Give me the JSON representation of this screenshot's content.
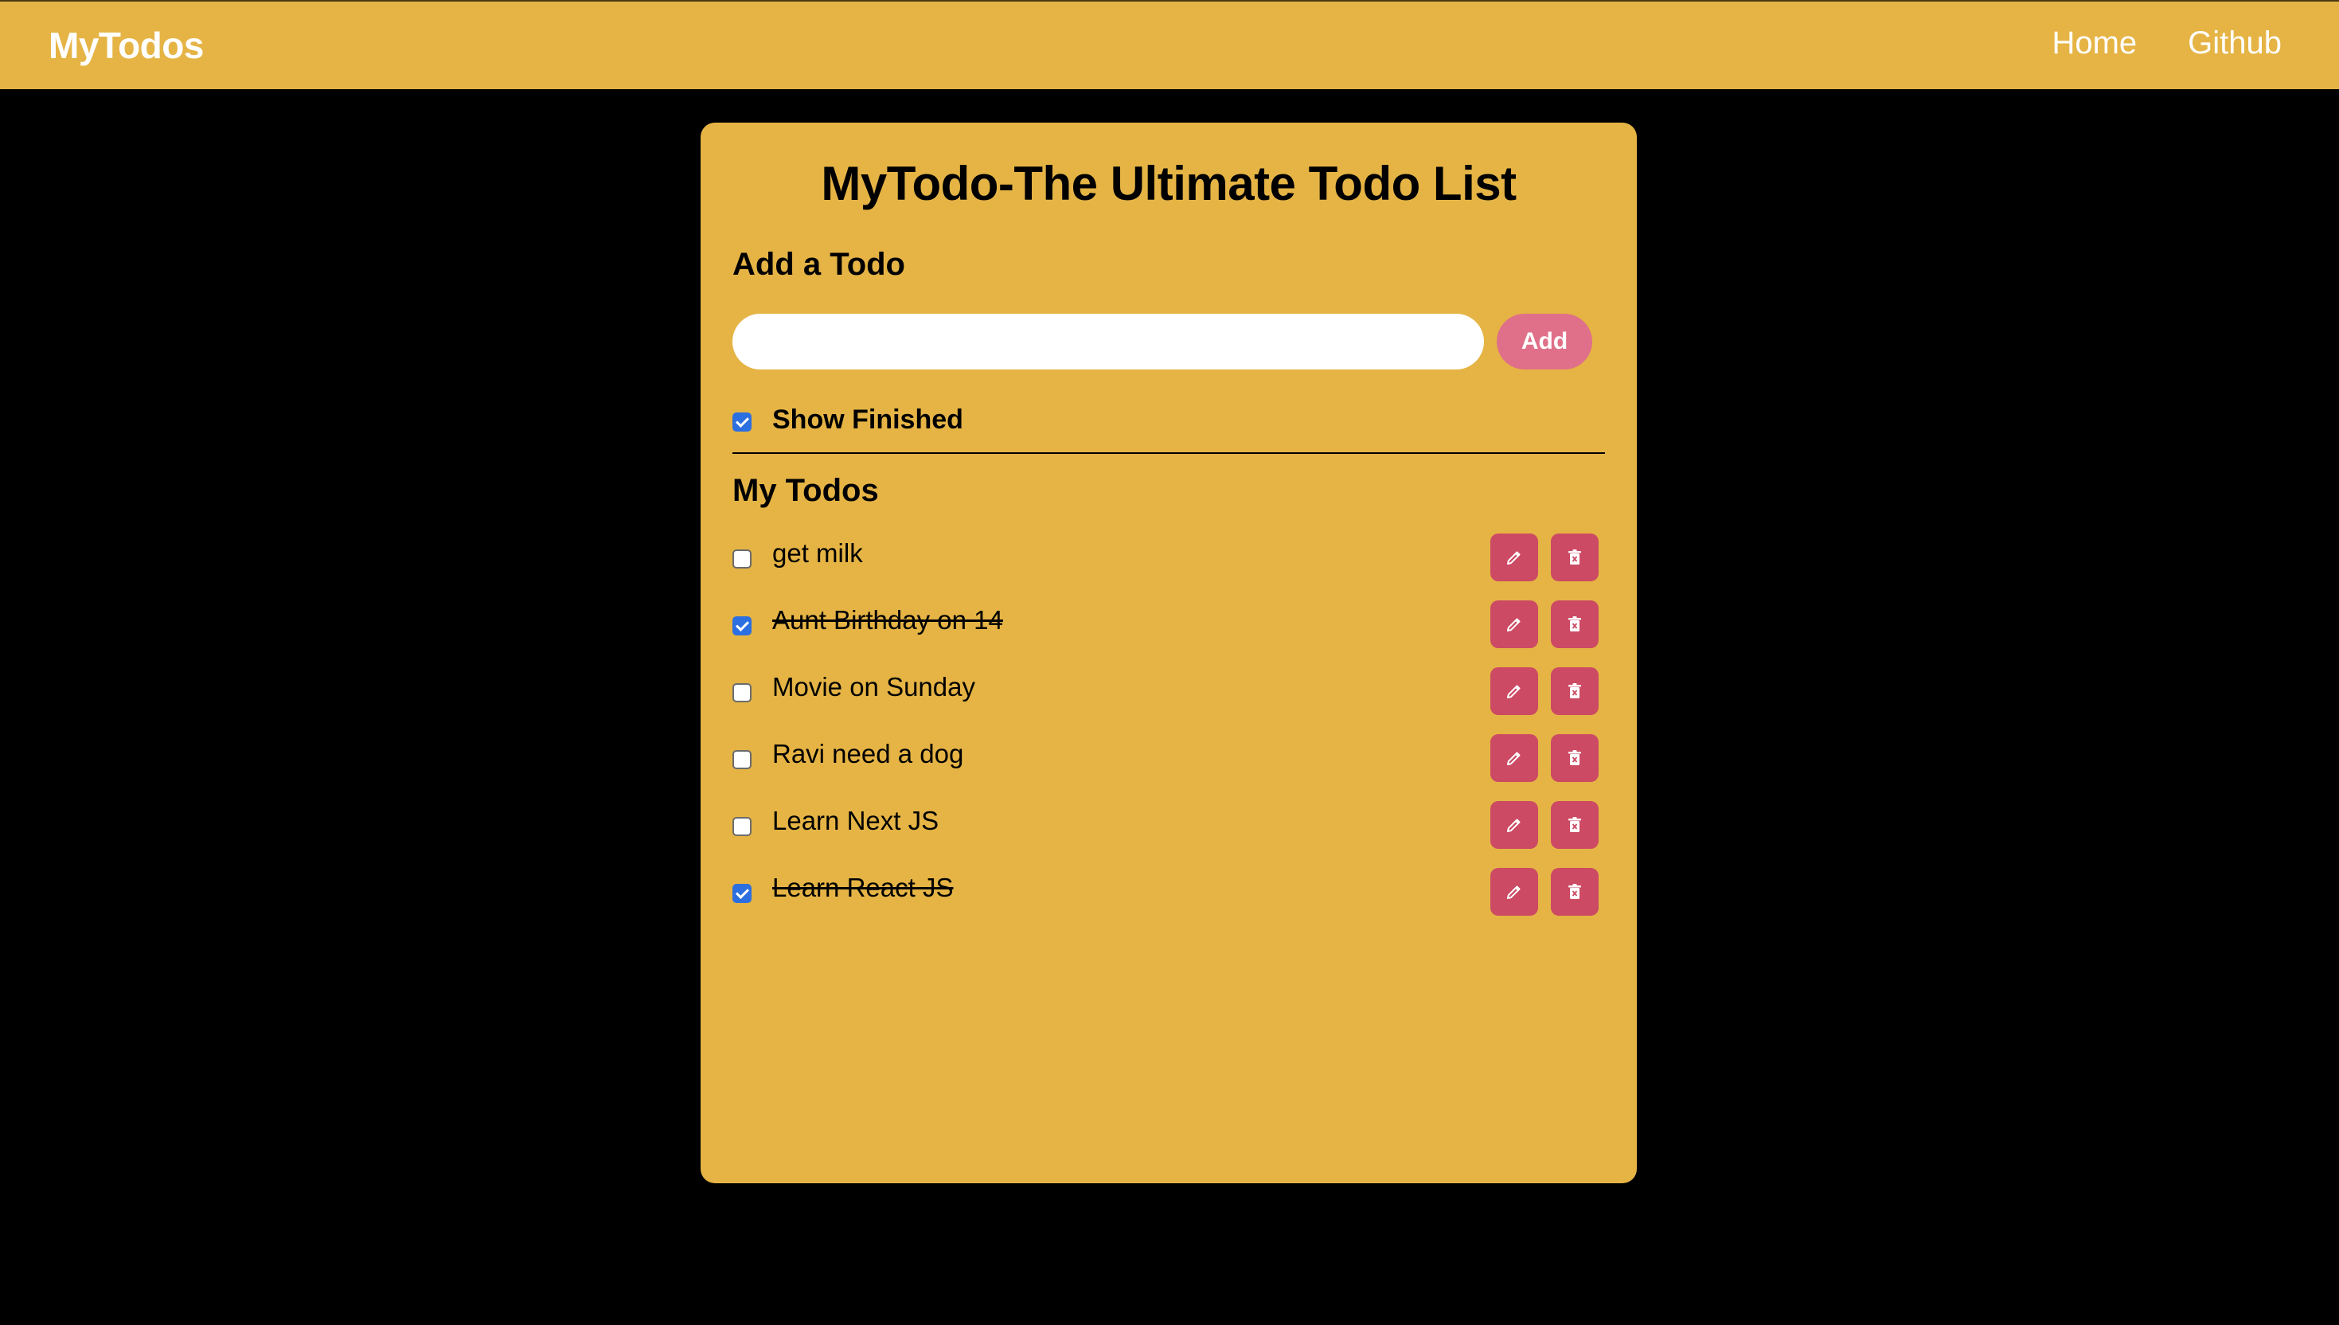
{
  "navbar": {
    "brand": "MyTodos",
    "links": [
      "Home",
      "Github"
    ]
  },
  "card": {
    "title": "MyTodo-The Ultimate Todo List",
    "add_heading": "Add a Todo",
    "input": {
      "value": "",
      "placeholder": ""
    },
    "add_label": "Add",
    "show_finished": {
      "label": "Show Finished",
      "checked": true
    },
    "list_heading": "My Todos"
  },
  "todos": [
    {
      "text": "get milk",
      "done": false
    },
    {
      "text": "Aunt Birthday on 14",
      "done": true
    },
    {
      "text": "Movie on Sunday",
      "done": false
    },
    {
      "text": "Ravi need a dog",
      "done": false
    },
    {
      "text": "Learn Next JS",
      "done": false
    },
    {
      "text": "Learn React JS",
      "done": true
    }
  ],
  "icons": {
    "edit": "pencil-icon",
    "delete": "trash-icon"
  },
  "colors": {
    "background": "#000000",
    "surface": "#e5b445",
    "add_button": "#e07089",
    "action_button": "#cc4a63",
    "checkbox_checked": "#2c6fe0"
  }
}
